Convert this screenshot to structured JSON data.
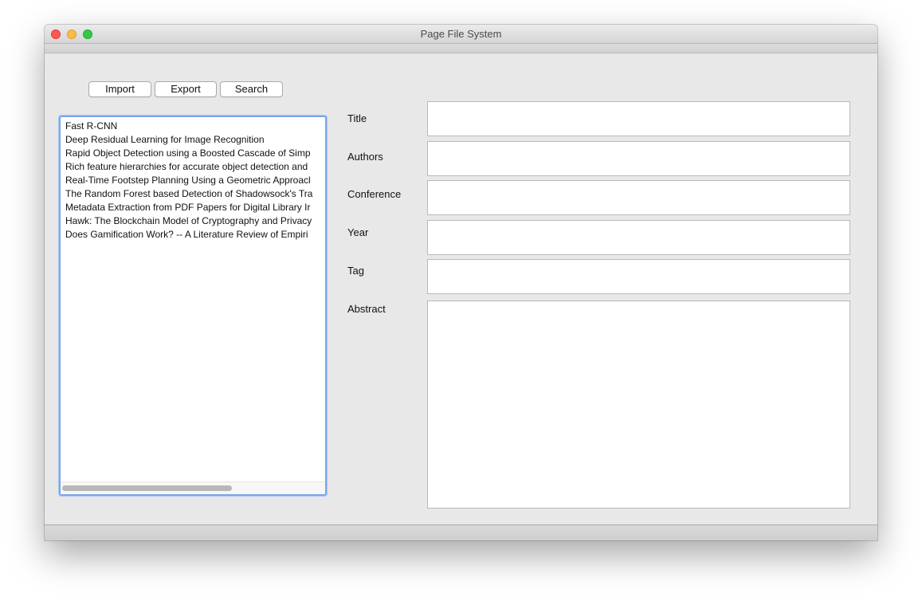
{
  "window": {
    "title": "Page File System"
  },
  "toolbar": {
    "import_label": "Import",
    "export_label": "Export",
    "search_label": "Search"
  },
  "papers": [
    "Fast R-CNN",
    "Deep Residual Learning for Image Recognition",
    "Rapid Object Detection using a Boosted Cascade of Simp",
    "Rich feature hierarchies for accurate object detection and",
    "Real-Time Footstep Planning Using a Geometric Approacl",
    "The Random Forest based Detection of Shadowsock's Tra",
    "Metadata Extraction from PDF Papers for Digital Library Ir",
    "Hawk: The Blockchain Model of Cryptography and Privacy",
    "Does Gamification Work? -- A Literature Review of Empiri"
  ],
  "form": {
    "title_label": "Title",
    "title_value": "",
    "authors_label": "Authors",
    "authors_value": "",
    "conference_label": "Conference",
    "conference_value": "",
    "year_label": "Year",
    "year_value": "",
    "tag_label": "Tag",
    "tag_value": "",
    "abstract_label": "Abstract",
    "abstract_value": ""
  }
}
